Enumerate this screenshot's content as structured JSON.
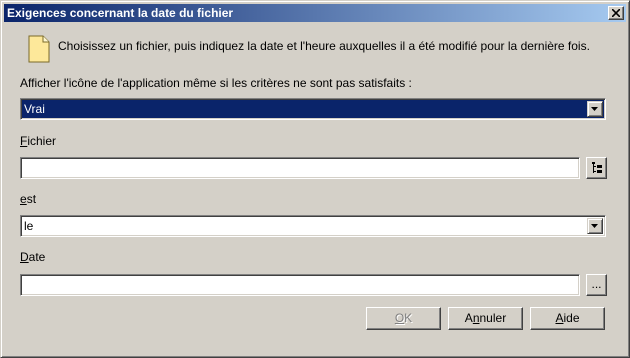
{
  "window": {
    "title": "Exigences concernant la date du fichier"
  },
  "intro_text": "Choisissez un fichier, puis indiquez la date et l'heure auxquelles il a été modifié pour la dernière fois.",
  "show_icon": {
    "label": "Afficher l'icône de l'application même si les critères ne sont pas satisfaits :",
    "value": "Vrai"
  },
  "file": {
    "label_mnemonic": "F",
    "label_rest": "ichier",
    "value": ""
  },
  "operator": {
    "label_mnemonic": "e",
    "label_rest": "st",
    "value": "le"
  },
  "date": {
    "label_mnemonic": "D",
    "label_rest": "ate",
    "value": "",
    "browse_label": "..."
  },
  "buttons": {
    "ok_mnemonic": "O",
    "ok_rest": "K",
    "cancel_pre": "A",
    "cancel_mnemonic": "n",
    "cancel_rest": "nuler",
    "help_mnemonic": "A",
    "help_rest": "ide"
  },
  "icons": {
    "close": "close-icon",
    "document": "document-icon",
    "dropdown": "chevron-down-icon",
    "file_browse": "browse-tree-icon"
  }
}
